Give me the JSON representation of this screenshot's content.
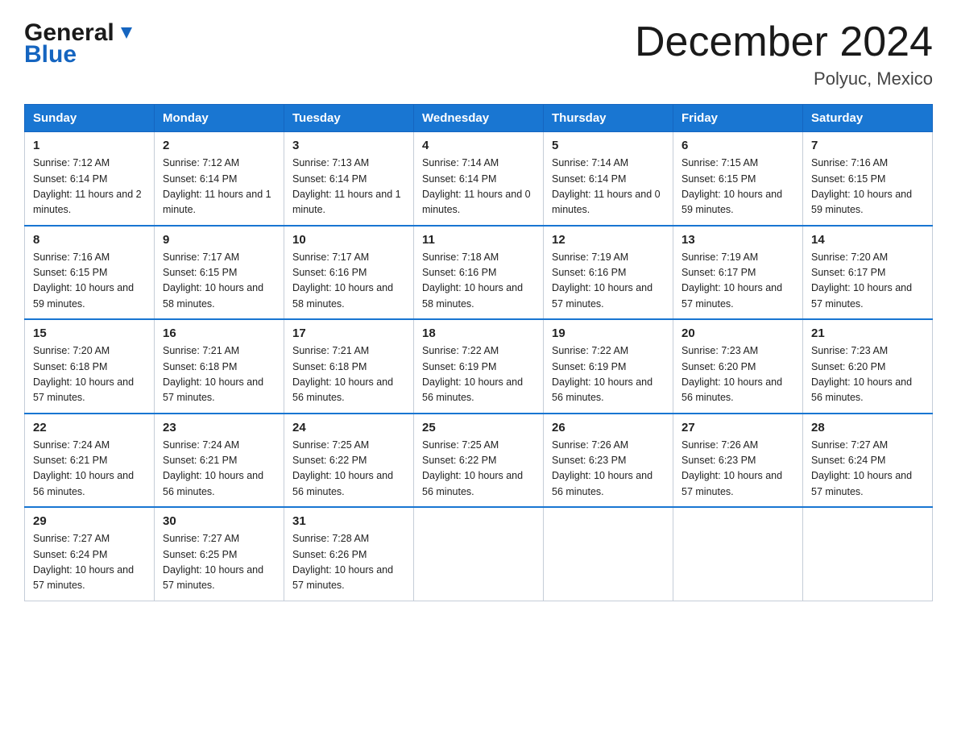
{
  "logo": {
    "line1": "General",
    "line2": "Blue"
  },
  "title": "December 2024",
  "location": "Polyuc, Mexico",
  "days_of_week": [
    "Sunday",
    "Monday",
    "Tuesday",
    "Wednesday",
    "Thursday",
    "Friday",
    "Saturday"
  ],
  "weeks": [
    [
      {
        "day": "1",
        "sunrise": "7:12 AM",
        "sunset": "6:14 PM",
        "daylight": "11 hours and 2 minutes."
      },
      {
        "day": "2",
        "sunrise": "7:12 AM",
        "sunset": "6:14 PM",
        "daylight": "11 hours and 1 minute."
      },
      {
        "day": "3",
        "sunrise": "7:13 AM",
        "sunset": "6:14 PM",
        "daylight": "11 hours and 1 minute."
      },
      {
        "day": "4",
        "sunrise": "7:14 AM",
        "sunset": "6:14 PM",
        "daylight": "11 hours and 0 minutes."
      },
      {
        "day": "5",
        "sunrise": "7:14 AM",
        "sunset": "6:14 PM",
        "daylight": "11 hours and 0 minutes."
      },
      {
        "day": "6",
        "sunrise": "7:15 AM",
        "sunset": "6:15 PM",
        "daylight": "10 hours and 59 minutes."
      },
      {
        "day": "7",
        "sunrise": "7:16 AM",
        "sunset": "6:15 PM",
        "daylight": "10 hours and 59 minutes."
      }
    ],
    [
      {
        "day": "8",
        "sunrise": "7:16 AM",
        "sunset": "6:15 PM",
        "daylight": "10 hours and 59 minutes."
      },
      {
        "day": "9",
        "sunrise": "7:17 AM",
        "sunset": "6:15 PM",
        "daylight": "10 hours and 58 minutes."
      },
      {
        "day": "10",
        "sunrise": "7:17 AM",
        "sunset": "6:16 PM",
        "daylight": "10 hours and 58 minutes."
      },
      {
        "day": "11",
        "sunrise": "7:18 AM",
        "sunset": "6:16 PM",
        "daylight": "10 hours and 58 minutes."
      },
      {
        "day": "12",
        "sunrise": "7:19 AM",
        "sunset": "6:16 PM",
        "daylight": "10 hours and 57 minutes."
      },
      {
        "day": "13",
        "sunrise": "7:19 AM",
        "sunset": "6:17 PM",
        "daylight": "10 hours and 57 minutes."
      },
      {
        "day": "14",
        "sunrise": "7:20 AM",
        "sunset": "6:17 PM",
        "daylight": "10 hours and 57 minutes."
      }
    ],
    [
      {
        "day": "15",
        "sunrise": "7:20 AM",
        "sunset": "6:18 PM",
        "daylight": "10 hours and 57 minutes."
      },
      {
        "day": "16",
        "sunrise": "7:21 AM",
        "sunset": "6:18 PM",
        "daylight": "10 hours and 57 minutes."
      },
      {
        "day": "17",
        "sunrise": "7:21 AM",
        "sunset": "6:18 PM",
        "daylight": "10 hours and 56 minutes."
      },
      {
        "day": "18",
        "sunrise": "7:22 AM",
        "sunset": "6:19 PM",
        "daylight": "10 hours and 56 minutes."
      },
      {
        "day": "19",
        "sunrise": "7:22 AM",
        "sunset": "6:19 PM",
        "daylight": "10 hours and 56 minutes."
      },
      {
        "day": "20",
        "sunrise": "7:23 AM",
        "sunset": "6:20 PM",
        "daylight": "10 hours and 56 minutes."
      },
      {
        "day": "21",
        "sunrise": "7:23 AM",
        "sunset": "6:20 PM",
        "daylight": "10 hours and 56 minutes."
      }
    ],
    [
      {
        "day": "22",
        "sunrise": "7:24 AM",
        "sunset": "6:21 PM",
        "daylight": "10 hours and 56 minutes."
      },
      {
        "day": "23",
        "sunrise": "7:24 AM",
        "sunset": "6:21 PM",
        "daylight": "10 hours and 56 minutes."
      },
      {
        "day": "24",
        "sunrise": "7:25 AM",
        "sunset": "6:22 PM",
        "daylight": "10 hours and 56 minutes."
      },
      {
        "day": "25",
        "sunrise": "7:25 AM",
        "sunset": "6:22 PM",
        "daylight": "10 hours and 56 minutes."
      },
      {
        "day": "26",
        "sunrise": "7:26 AM",
        "sunset": "6:23 PM",
        "daylight": "10 hours and 56 minutes."
      },
      {
        "day": "27",
        "sunrise": "7:26 AM",
        "sunset": "6:23 PM",
        "daylight": "10 hours and 57 minutes."
      },
      {
        "day": "28",
        "sunrise": "7:27 AM",
        "sunset": "6:24 PM",
        "daylight": "10 hours and 57 minutes."
      }
    ],
    [
      {
        "day": "29",
        "sunrise": "7:27 AM",
        "sunset": "6:24 PM",
        "daylight": "10 hours and 57 minutes."
      },
      {
        "day": "30",
        "sunrise": "7:27 AM",
        "sunset": "6:25 PM",
        "daylight": "10 hours and 57 minutes."
      },
      {
        "day": "31",
        "sunrise": "7:28 AM",
        "sunset": "6:26 PM",
        "daylight": "10 hours and 57 minutes."
      },
      null,
      null,
      null,
      null
    ]
  ]
}
